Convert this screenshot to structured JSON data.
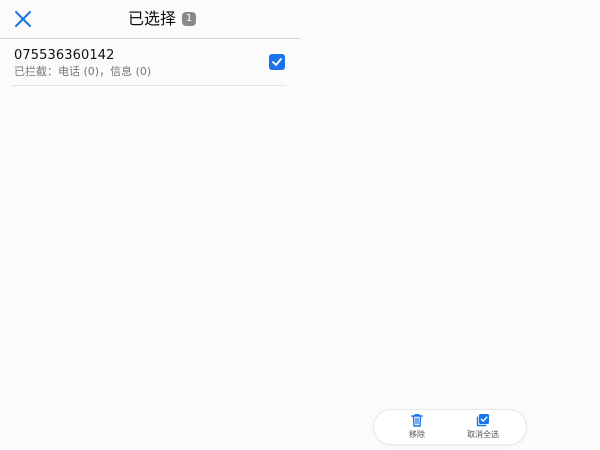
{
  "header": {
    "title": "已选择",
    "selected_count": "1",
    "close_icon": "close-icon"
  },
  "list": {
    "items": [
      {
        "number": "075536360142",
        "detail": "已拦截：电话 (0)，信息 (0)",
        "checked": true
      }
    ]
  },
  "bottom_actions": {
    "remove_label": "移除",
    "deselect_all_label": "取消全选",
    "remove_icon": "trash-icon",
    "deselect_all_icon": "select-all-icon"
  },
  "colors": {
    "accent": "#1a73e8",
    "background": "#fbfbfb",
    "badge": "#8a8a8a"
  }
}
